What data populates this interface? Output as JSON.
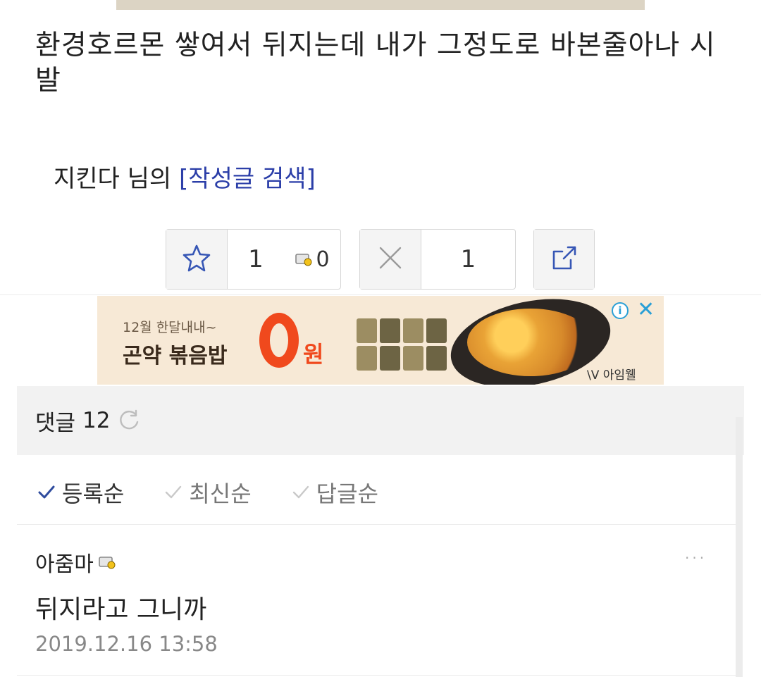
{
  "post": {
    "body": "환경호르몬 쌓여서 뒤지는데 내가 그정도로 바본줄아나 시발",
    "author_name": "지킨다",
    "author_suffix": " 님의 ",
    "search_link": "[작성글 검색]"
  },
  "actions": {
    "recommend_count": "1",
    "recommend_badge_count": "0",
    "dislike_count": "1",
    "icons": [
      "star-icon",
      "badge-icon",
      "close-icon",
      "share-icon"
    ]
  },
  "ad": {
    "line1": "12월 한달내내~",
    "line2": "곤약 볶음밥",
    "won": "원",
    "brand": "\\V 아임웰",
    "info_icon": "i",
    "close_icon": "✕"
  },
  "comments": {
    "label": "댓글",
    "count": "12",
    "sort_tabs": [
      {
        "label": "등록순",
        "active": true
      },
      {
        "label": "최신순",
        "active": false
      },
      {
        "label": "답글순",
        "active": false
      }
    ],
    "items": [
      {
        "author": "아줌마",
        "text": "뒤지라고 그니까",
        "time": "2019.12.16 13:58",
        "more": "···"
      }
    ]
  }
}
